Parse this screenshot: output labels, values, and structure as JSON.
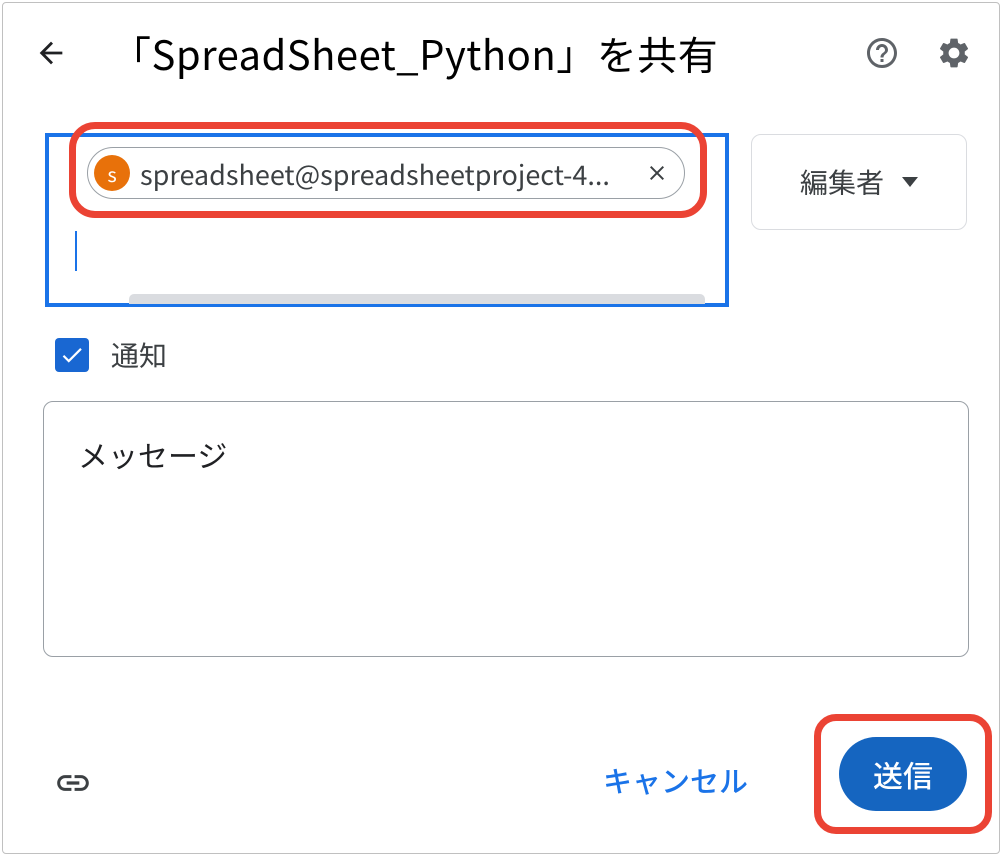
{
  "header": {
    "title": "「SpreadSheet_Python」を共有"
  },
  "recipient": {
    "chip_text": "spreadsheet@spreadsheetproject-4...",
    "avatar_initial": "s",
    "avatar_color": "#e8710a"
  },
  "role": {
    "label": "編集者"
  },
  "notify": {
    "label": "通知",
    "checked": true
  },
  "message": {
    "placeholder": "メッセージ"
  },
  "footer": {
    "cancel_label": "キャンセル",
    "send_label": "送信"
  }
}
